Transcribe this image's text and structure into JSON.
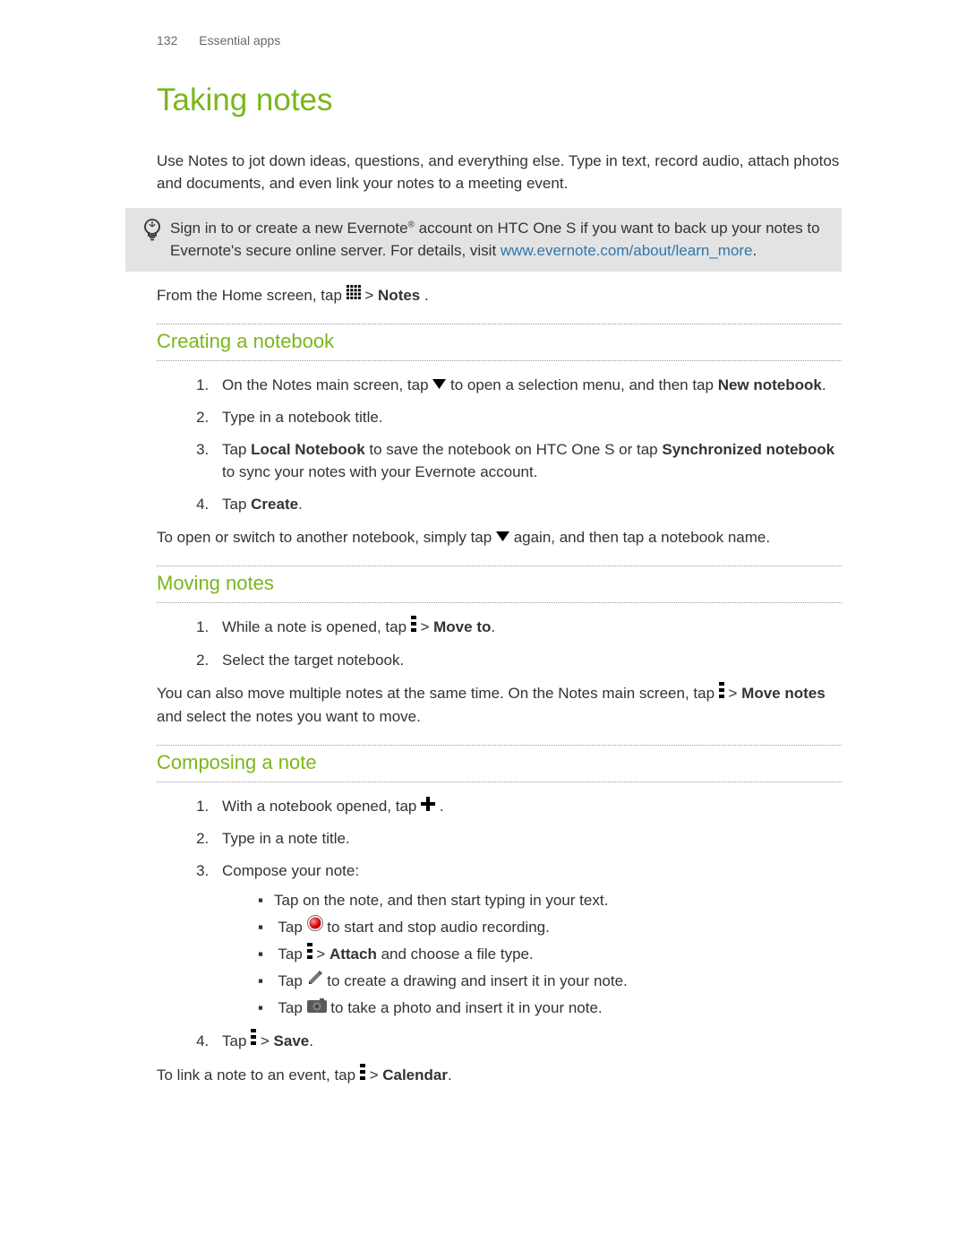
{
  "header": {
    "page_number": "132",
    "section": "Essential apps"
  },
  "title": "Taking notes",
  "intro": "Use Notes to jot down ideas, questions, and everything else. Type in text, record audio, attach photos and documents, and even link your notes to a meeting event.",
  "tip": {
    "part1": "Sign in to or create a new Evernote",
    "reg": "®",
    "part2": " account on HTC One S if you want to back up your notes to Evernote's secure online server. For details, visit ",
    "link_text": "www.evernote.com/about/learn_more",
    "part3": "."
  },
  "home_line": {
    "pre": "From the Home screen, tap ",
    "mid": " > ",
    "notes": "Notes",
    "post": " ."
  },
  "sections": {
    "creating": {
      "heading": "Creating a notebook",
      "steps": {
        "s1a": "On the Notes main screen, tap ",
        "s1b": " to open a selection menu, and then tap ",
        "s1c": "New notebook",
        "s1d": ".",
        "s2": "Type in a notebook title.",
        "s3a": "Tap ",
        "s3b": "Local Notebook",
        "s3c": " to save the notebook on HTC One S or tap ",
        "s3d": "Synchronized notebook",
        "s3e": " to sync your notes with your Evernote account.",
        "s4a": "Tap ",
        "s4b": "Create",
        "s4c": "."
      },
      "after_a": "To open or switch to another notebook, simply tap ",
      "after_b": " again, and then tap a notebook name."
    },
    "moving": {
      "heading": "Moving notes",
      "s1a": "While a note is opened, tap ",
      "s1b": " > ",
      "s1c": "Move to",
      "s1d": ".",
      "s2": "Select the target notebook.",
      "after_a": "You can also move multiple notes at the same time. On the Notes main screen, tap ",
      "after_b": " > ",
      "after_c": "Move notes",
      "after_d": " and select the notes you want to move."
    },
    "composing": {
      "heading": "Composing a note",
      "s1a": "With a notebook opened, tap ",
      "s1b": ".",
      "s2": "Type in a note title.",
      "s3": "Compose your note:",
      "b1": "Tap on the note, and then start typing in your text.",
      "b2a": "Tap ",
      "b2b": " to start and stop audio recording.",
      "b3a": "Tap ",
      "b3b": " > ",
      "b3c": "Attach",
      "b3d": " and choose a file type.",
      "b4a": "Tap ",
      "b4b": " to create a drawing and insert it in your note.",
      "b5a": "Tap ",
      "b5b": " to take a photo and insert it in your note.",
      "s4a": "Tap",
      "s4b": " > ",
      "s4c": "Save",
      "s4d": ".",
      "after_a": "To link a note to an event, tap ",
      "after_b": " > ",
      "after_c": "Calendar",
      "after_d": "."
    }
  }
}
